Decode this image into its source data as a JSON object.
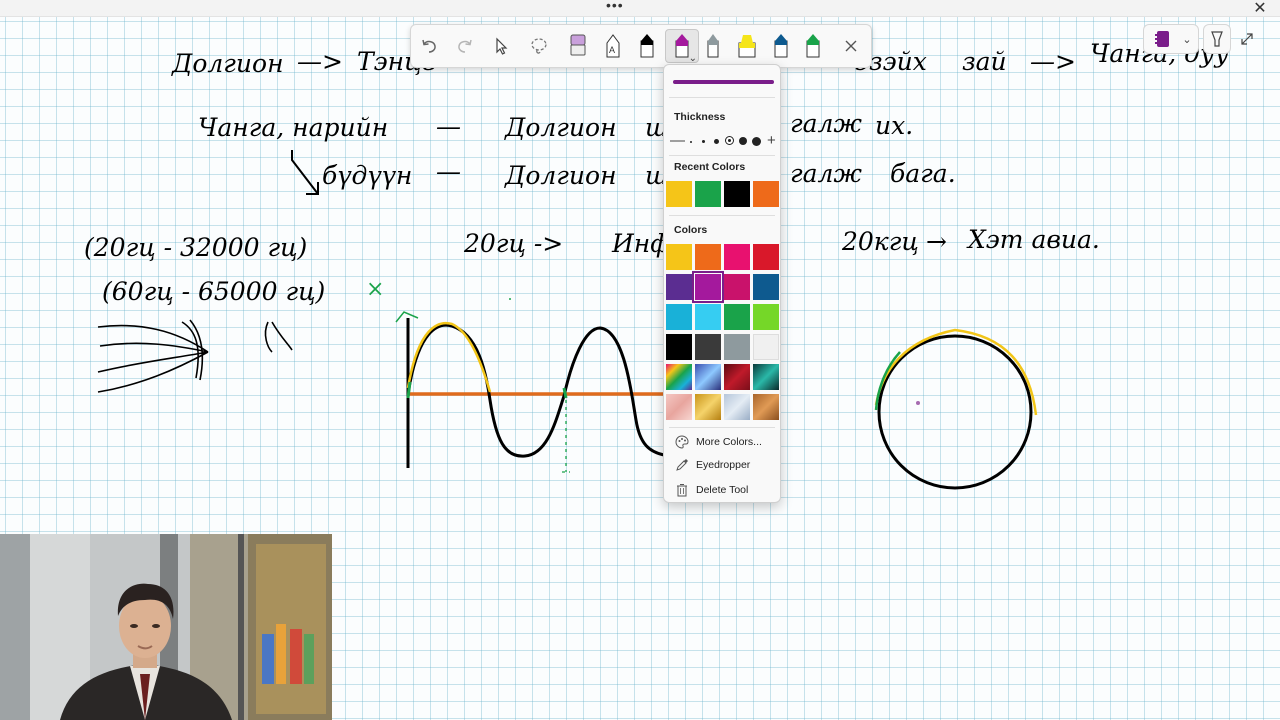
{
  "window": {
    "menu_dots": "•••",
    "close_glyph": "✕"
  },
  "notes": {
    "line1": {
      "a": "Долгион",
      "arrow1": "—>",
      "b": "Тэнцв",
      "c": "эзэйх",
      "d": "зай",
      "arrow2": "—>",
      "e": "Чанга, дуу"
    },
    "line2": {
      "a": "Чанга, нарийн",
      "dash": "—",
      "b": "Долгион",
      "c": "ш",
      "d": "галж",
      "e": "их."
    },
    "line3": {
      "a": "бүдүүн",
      "dash": "—",
      "b": "Долгион",
      "c": "ш",
      "d": "галж",
      "e": "бага."
    },
    "line4": {
      "a": "(20гц  - 32000 гц)",
      "b": "20гц ->",
      "c": "Инф",
      "d": "20кгц",
      "arrow": "→",
      "e": "Хэт авиа."
    },
    "line5": {
      "a": "(60гц -  65000 гц)"
    },
    "mark_x": "×"
  },
  "toolbar": {
    "tools": [
      {
        "name": "undo-button",
        "icon": "undo-icon"
      },
      {
        "name": "redo-button",
        "icon": "redo-icon"
      },
      {
        "name": "select-button",
        "icon": "cursor-icon"
      },
      {
        "name": "lasso-button",
        "icon": "lasso-icon"
      },
      {
        "name": "eraser-button",
        "icon": "eraser-icon"
      },
      {
        "name": "ink-to-text-pen-button",
        "icon": "pen-a-icon"
      },
      {
        "name": "black-pen-button",
        "icon": "pen-black-icon"
      },
      {
        "name": "purple-pen-button",
        "icon": "pen-purple-icon"
      },
      {
        "name": "gray-pen-button",
        "icon": "pen-gray-icon"
      },
      {
        "name": "yellow-highlighter-button",
        "icon": "highlighter-yellow-icon"
      },
      {
        "name": "blue-pen-button",
        "icon": "pen-blue-icon"
      },
      {
        "name": "green-pen-button",
        "icon": "pen-green-icon"
      },
      {
        "name": "close-toolbar-button",
        "icon": "close-icon"
      }
    ],
    "active_tool": "purple-pen-button",
    "chevron": "⌄"
  },
  "pen_popup": {
    "preview_color": "#7a1d8a",
    "thickness_title": "Thickness",
    "thickness_minus": "—",
    "thickness_plus": "+",
    "thickness_options": 6,
    "thickness_selected": 3,
    "recent_title": "Recent Colors",
    "recent_colors": [
      "#f5c518",
      "#1aa34a",
      "#000000",
      "#ee6a1a"
    ],
    "colors_title": "Colors",
    "colors": [
      "#f5c518",
      "#ee6a1a",
      "#e8116f",
      "#d9182a",
      "#5b2d91",
      "#a4199d",
      "#c9126b",
      "#0e5a8f",
      "#19b1d8",
      "#36cdf2",
      "#1aa34a",
      "#75d728",
      "#000000",
      "#3a3a3a",
      "#8e9a9e",
      "#f0f0f0",
      "rainbow",
      "galaxy",
      "ruby",
      "aurora",
      "rosegold",
      "gold",
      "silver",
      "bronze"
    ],
    "selected_color": "#a4199d",
    "menu": {
      "more_colors": "More Colors...",
      "eyedropper": "Eyedropper",
      "delete_tool": "Delete Tool"
    }
  },
  "ink_colors": {
    "black": "#000000",
    "orange": "#e06b1d",
    "yellow": "#f2c518",
    "green": "#1aa34a",
    "purple": "#7a1d8a"
  }
}
